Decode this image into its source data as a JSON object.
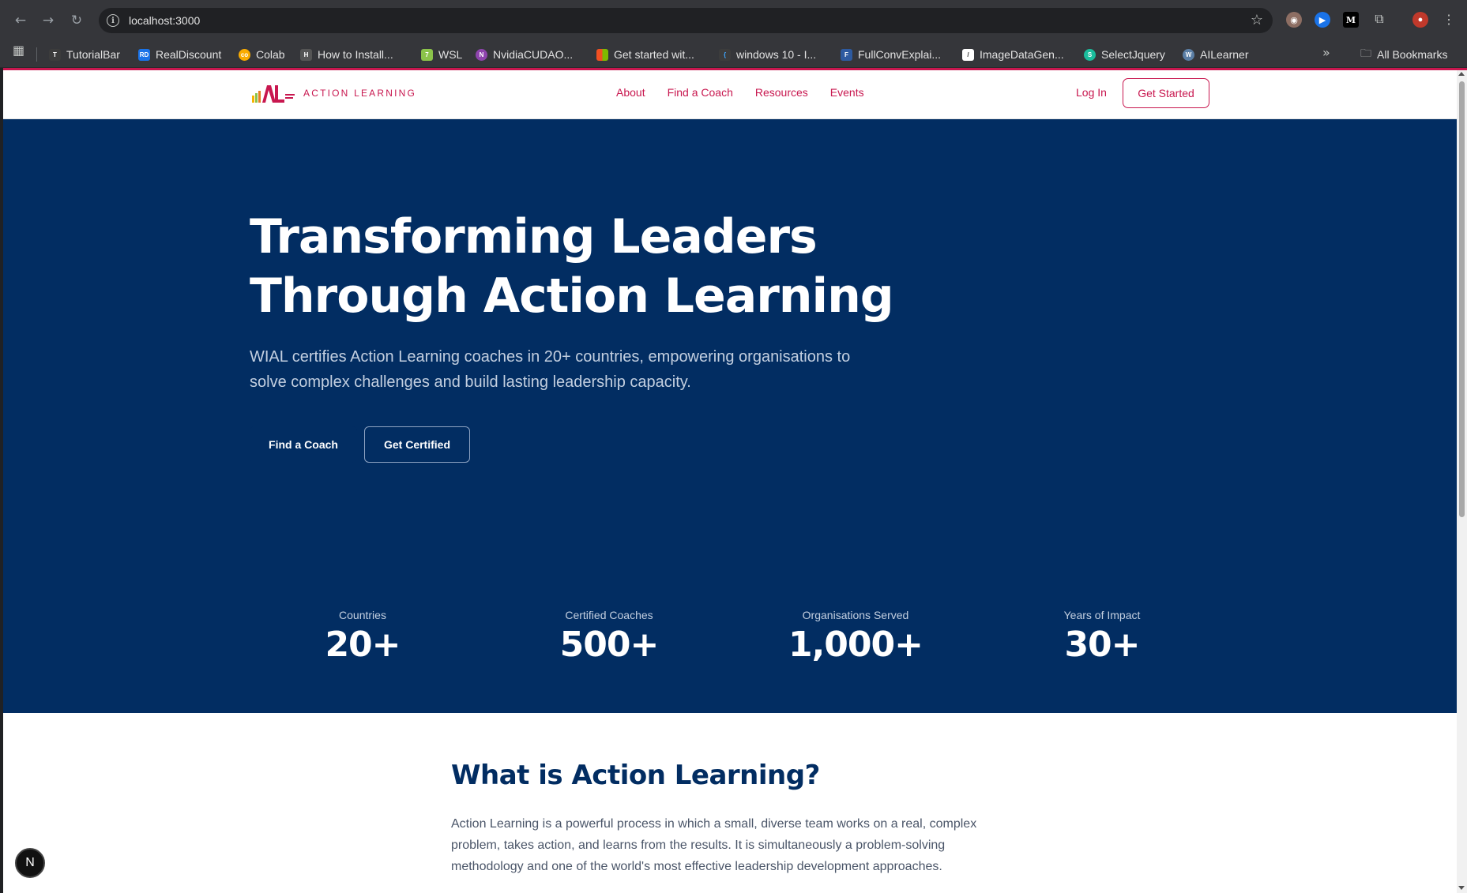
{
  "browser": {
    "url": "localhost:3000",
    "bookmarks": [
      {
        "label": "TutorialBar",
        "color": "#3c3c3c",
        "glyph": "T"
      },
      {
        "label": "RealDiscount",
        "color": "#1a73e8",
        "glyph": "RD"
      },
      {
        "label": "Colab",
        "color": "#f9ab00",
        "glyph": "co"
      },
      {
        "label": "How to Install...",
        "color": "#555",
        "glyph": "H"
      },
      {
        "label": "WSL",
        "color": "#8bc34a",
        "glyph": "7"
      },
      {
        "label": "NvidiaCUDAO...",
        "color": "#8e44ad",
        "glyph": "N"
      },
      {
        "label": "Get started wit...",
        "color": "#f25022",
        "glyph": ""
      },
      {
        "label": "windows 10 - I...",
        "color": "#3c3c3c",
        "glyph": "{"
      },
      {
        "label": "FullConvExplai...",
        "color": "#2d5aa0",
        "glyph": "F"
      },
      {
        "label": "ImageDataGen...",
        "color": "#ffffff",
        "glyph": "/"
      },
      {
        "label": "SelectJquery",
        "color": "#1abc9c",
        "glyph": "S"
      },
      {
        "label": "AILearner",
        "color": "#5b7fa6",
        "glyph": "W"
      }
    ],
    "all_bookmarks": "All Bookmarks"
  },
  "header": {
    "logo_text": "ACTION LEARNING",
    "nav": [
      "About",
      "Find a Coach",
      "Resources",
      "Events"
    ],
    "login": "Log In",
    "cta": "Get Started"
  },
  "hero": {
    "title_line1": "Transforming Leaders",
    "title_line2": "Through Action Learning",
    "subtitle": "WIAL certifies Action Learning coaches in 20+ countries, empowering organisations to solve complex challenges and build lasting leadership capacity.",
    "primary_button": "Find a Coach",
    "secondary_button": "Get Certified"
  },
  "stats": [
    {
      "label": "Countries",
      "value": "20+"
    },
    {
      "label": "Certified Coaches",
      "value": "500+"
    },
    {
      "label": "Organisations Served",
      "value": "1,000+"
    },
    {
      "label": "Years of Impact",
      "value": "30+"
    }
  ],
  "what_is": {
    "title": "What is Action Learning?",
    "body": "Action Learning is a powerful process in which a small, diverse team works on a real, complex problem, takes action, and learns from the results. It is simultaneously a problem-solving methodology and one of the world's most effective leadership development approaches."
  },
  "dev_badge": "N",
  "colors": {
    "accent": "#c8174f",
    "navy": "#022d62"
  }
}
